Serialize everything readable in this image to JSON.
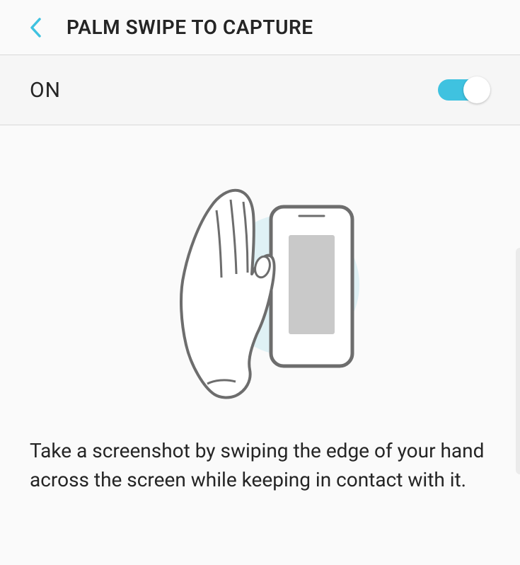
{
  "header": {
    "title": "PALM SWIPE TO CAPTURE"
  },
  "toggle": {
    "label": "ON",
    "state": true
  },
  "description": "Take a screenshot by swiping the edge of your hand across the screen while keeping in contact with it.",
  "colors": {
    "accent": "#3fc2e0"
  }
}
